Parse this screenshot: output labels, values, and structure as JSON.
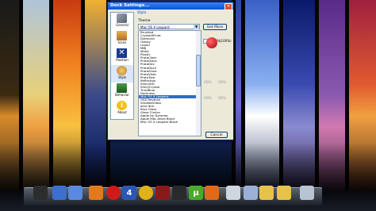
{
  "window": {
    "title": "Dock Settings..."
  },
  "sidebar": {
    "items": [
      {
        "label": "General",
        "icon": "wrench-tools-icon"
      },
      {
        "label": "Icons",
        "icon": "package-icon"
      },
      {
        "label": "Position",
        "icon": "position-cross-icon"
      },
      {
        "label": "Style",
        "icon": "palette-icon"
      },
      {
        "label": "Behavior",
        "icon": "behavior-monitor-icon"
      },
      {
        "label": "About",
        "icon": "info-icon"
      }
    ]
  },
  "style": {
    "section": "Style",
    "theme_label": "Theme",
    "theme_value": "Mac OS X Leopard",
    "get_more": "Get More",
    "opacity_value": "100%",
    "opacity_value_right": "(100%)",
    "theme_list": [
      "Brushed",
      "CrystalXP.net",
      "Diamond",
      "Glassy",
      "Liquid",
      "MBJ",
      "Metal",
      "Plastic",
      "ProtoClear",
      "ProtoGlass",
      "ProtoDev",
      "ProtoDock",
      "ProtoSilver",
      "ProtoVista",
      "ProtoTree",
      "Reflection",
      "ShinyIXD",
      "ShinyCrystal",
      "TiredBlue",
      "Darkness",
      "Mac OS X Leopard",
      "OSX Reverse",
      "SmokedGlass",
      "aero dim",
      "Blue Glass",
      "Glass Circles",
      "Apple by Dyrsmar",
      "Apple Mac Aldra Black",
      "Mac OS X Leopard Black"
    ],
    "selected_theme": "Mac OS X Leopard",
    "faded_labels": [
      "ON%",
      "ON%",
      "ON%",
      "ON%"
    ]
  },
  "footer": {
    "cancel": "Cancel"
  },
  "dock": {
    "icons": [
      {
        "name": "folder-icon",
        "color": "#2c2c2c"
      },
      {
        "name": "computer-icon",
        "color": "#3d6fd0"
      },
      {
        "name": "network-icon",
        "color": "#5a8ae0"
      },
      {
        "name": "media-player-icon",
        "color": "#e07a1a"
      },
      {
        "name": "lastfm-icon",
        "color": "#d01a1a"
      },
      {
        "name": "badge-4-icon",
        "color": "#2a57b8"
      },
      {
        "name": "chrome-icon",
        "color": "#e0b21a"
      },
      {
        "name": "cross-app-icon",
        "color": "#8a1a1a"
      },
      {
        "name": "cursor-app-icon",
        "color": "#2a2a2a"
      },
      {
        "name": "utorrent-icon",
        "color": "#4aa82a"
      },
      {
        "name": "refresh-app-icon",
        "color": "#e06a1a"
      },
      {
        "name": "document-icon",
        "color": "#cfd6e0"
      },
      {
        "name": "documents-icon",
        "color": "#9ab0d6"
      },
      {
        "name": "folder-yellow-icon",
        "color": "#e6c24a"
      },
      {
        "name": "folder-yellow-2-icon",
        "color": "#e6c24a"
      },
      {
        "name": "recycle-bin-icon",
        "color": "#b8c4d2"
      }
    ],
    "badge_text": "4",
    "utorrent_text": "µ"
  }
}
